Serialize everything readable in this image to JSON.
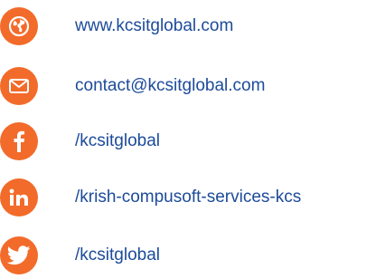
{
  "colors": {
    "accent": "#F26B2A",
    "text": "#1C4B9A"
  },
  "contacts": [
    {
      "icon": "globe-icon",
      "label": "www.kcsitglobal.com"
    },
    {
      "icon": "mail-icon",
      "label": "contact@kcsitglobal.com"
    },
    {
      "icon": "facebook-icon",
      "label": "/kcsitglobal"
    },
    {
      "icon": "linkedin-icon",
      "label": "/krish-compusoft-services-kcs"
    },
    {
      "icon": "twitter-icon",
      "label": "/kcsitglobal"
    }
  ]
}
